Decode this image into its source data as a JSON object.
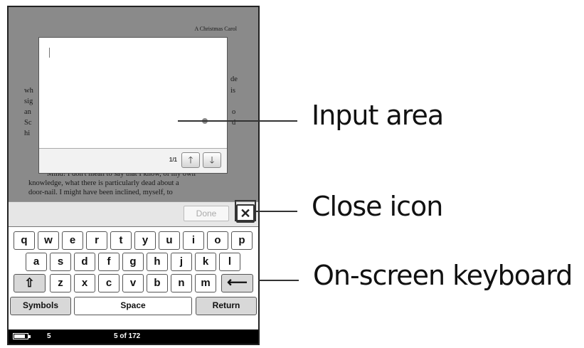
{
  "reader": {
    "book_title": "A Christmas Carol",
    "paragraph_lines": [
      "Mind! I don't mean to say that I know, of my own",
      "knowledge, what there is particularly dead about a",
      "door-nail. I might have been inclined, myself, to"
    ],
    "fragments": [
      "wh",
      "sig",
      "an",
      "Sc",
      "hi",
      "de",
      "is",
      "o",
      "d"
    ]
  },
  "input_dialog": {
    "page_indicator": "1/1",
    "up_icon": "arrow-up-icon",
    "down_icon": "arrow-down-icon",
    "up_glyph": "🡑",
    "down_glyph": "🡓"
  },
  "done_bar": {
    "done_label": "Done",
    "close_glyph": "✕",
    "close_icon": "close-icon"
  },
  "keyboard": {
    "row1": [
      "q",
      "w",
      "e",
      "r",
      "t",
      "y",
      "u",
      "i",
      "o",
      "p"
    ],
    "row2": [
      "a",
      "s",
      "d",
      "f",
      "g",
      "h",
      "j",
      "k",
      "l"
    ],
    "row3": [
      "z",
      "x",
      "c",
      "v",
      "b",
      "n",
      "m"
    ],
    "shift_glyph": "⇧",
    "backspace_glyph": "⟵",
    "symbols_label": "Symbols",
    "space_label": "Space",
    "return_label": "Return"
  },
  "status": {
    "battery_icon": "battery-icon",
    "number": "5",
    "page": "5 of 172"
  },
  "callouts": {
    "input_area": "Input area",
    "close_icon": "Close icon",
    "keyboard": "On-screen keyboard"
  },
  "colors": {
    "device_bg": "#8a8a8a",
    "status_bar": "#000000",
    "keyboard_bg": "#ffffff"
  }
}
